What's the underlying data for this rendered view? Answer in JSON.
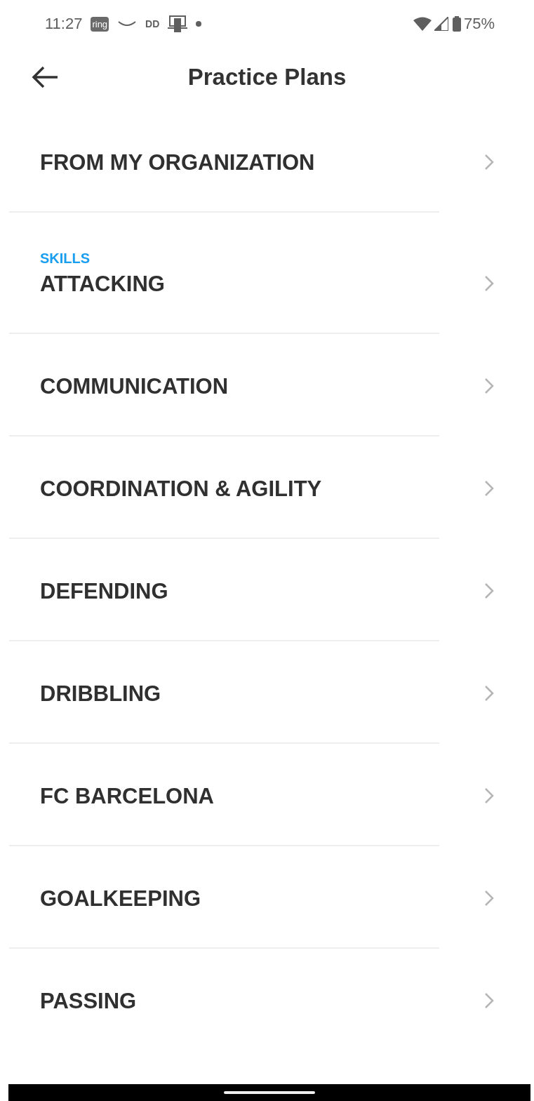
{
  "status_bar": {
    "time": "11:27",
    "notification_icons": [
      {
        "kind": "badge",
        "label": "ring"
      },
      {
        "kind": "smile"
      },
      {
        "kind": "text",
        "label": "DD"
      },
      {
        "kind": "device"
      },
      {
        "kind": "dot"
      }
    ],
    "battery": "75%"
  },
  "header": {
    "title": "Practice Plans"
  },
  "top_items": [
    {
      "label": "FROM MY ORGANIZATION"
    }
  ],
  "section": {
    "title": "SKILLS",
    "items": [
      {
        "label": "ATTACKING"
      },
      {
        "label": "COMMUNICATION"
      },
      {
        "label": "COORDINATION & AGILITY"
      },
      {
        "label": "DEFENDING"
      },
      {
        "label": "DRIBBLING"
      },
      {
        "label": "FC BARCELONA"
      },
      {
        "label": "GOALKEEPING"
      },
      {
        "label": "PASSING"
      }
    ]
  }
}
